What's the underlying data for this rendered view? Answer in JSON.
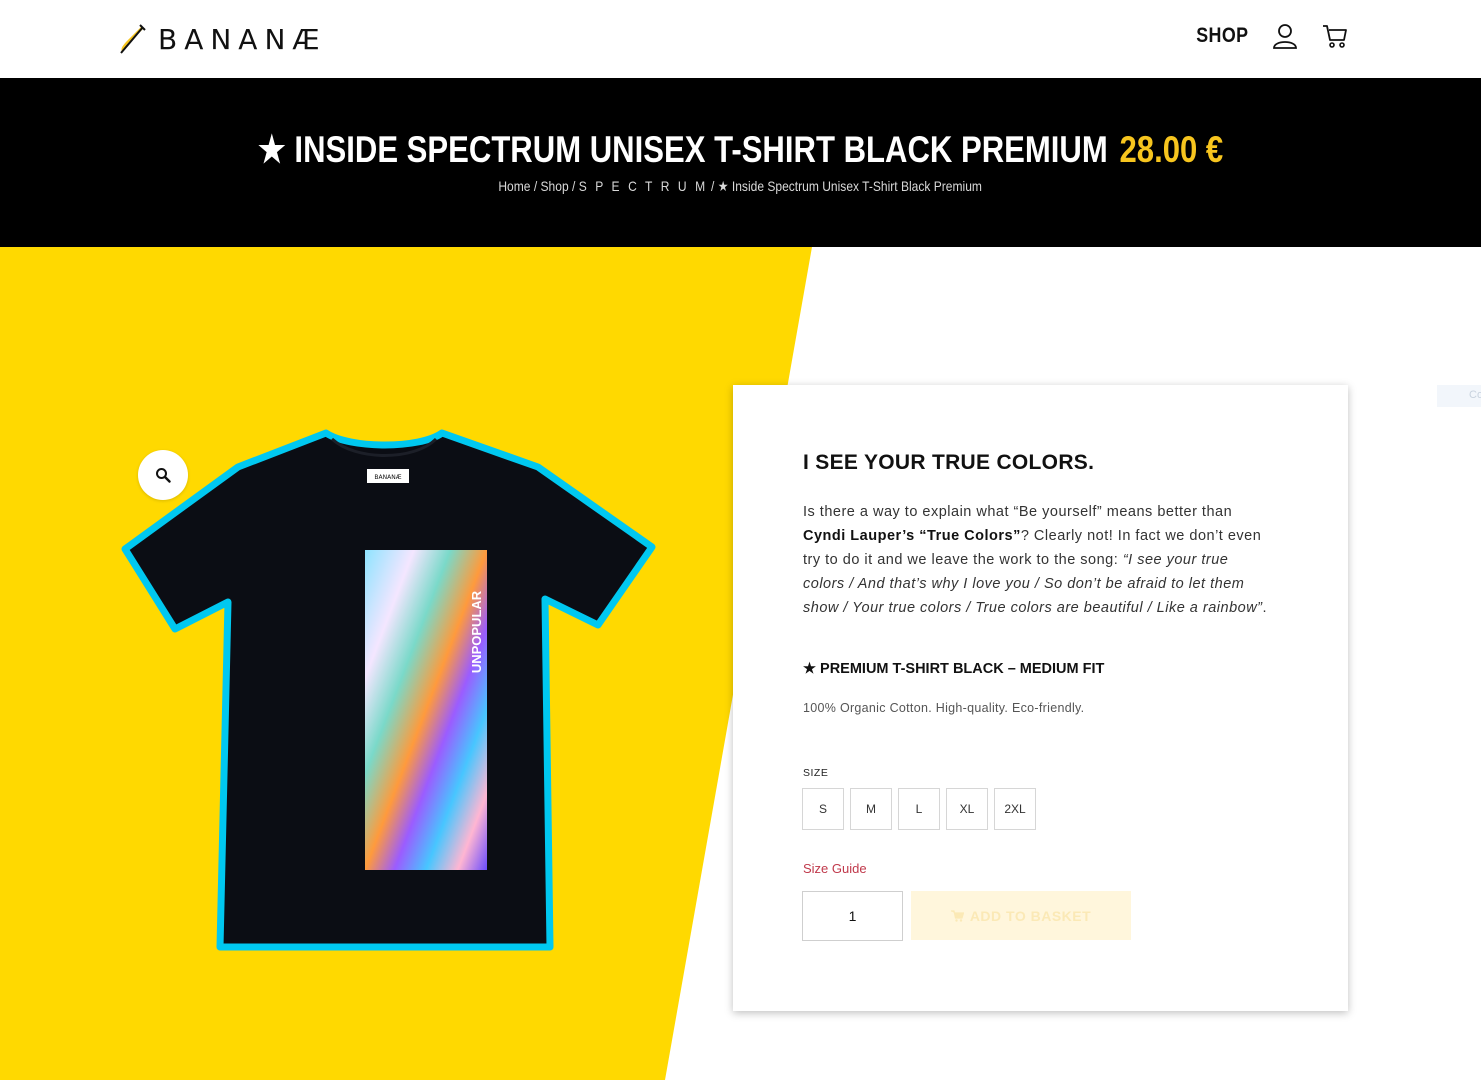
{
  "header": {
    "logo_text": "BANANÆ",
    "nav": {
      "shop_label": "SHOP",
      "account_icon": "user-icon",
      "cart_icon": "cart-icon"
    }
  },
  "banner": {
    "title": "★ INSIDE SPECTRUM UNISEX T-SHIRT BLACK PREMIUM",
    "price": "28.00 €",
    "breadcrumb": {
      "home": "Home",
      "shop": "Shop",
      "category": "S P E C T R U M",
      "current": "★ Inside Spectrum Unisex T-Shirt Black Premium",
      "separator": " / "
    }
  },
  "product": {
    "image_tag_text": "BANANÆ",
    "print_text": "UNPOPULAR",
    "zoom_icon": "magnifier-icon"
  },
  "card": {
    "heading": "I SEE YOUR TRUE COLORS.",
    "desc_part1": "Is there a way to explain what “Be yourself” means better than ",
    "desc_bold": "Cyndi Lauper’s “True Colors”",
    "desc_part2": "? Clearly not! In fact we don’t even try to do it and we leave the work to the song: ",
    "desc_italic": "“I see your true colors / And that’s why I love you / So don’t be afraid to let them show / Your true colors / True colors are beautiful / Like a rainbow”",
    "desc_end": ".",
    "premium": "★ PREMIUM T-SHIRT BLACK – MEDIUM FIT",
    "material": "100% Organic Cotton. High-quality. Eco-friendly.",
    "size_label": "SIZE",
    "sizes": [
      "S",
      "M",
      "L",
      "XL",
      "2XL"
    ],
    "size_guide": "Size Guide",
    "quantity": "1",
    "add_to_basket": "ADD TO BASKET"
  },
  "edge_tab_text": "Co",
  "colors": {
    "accent_yellow": "#FFD900",
    "price_yellow": "#F7C51E",
    "banner_black": "#000000",
    "shirt_outline": "#00C8F0",
    "size_guide_red": "#C0394B"
  }
}
